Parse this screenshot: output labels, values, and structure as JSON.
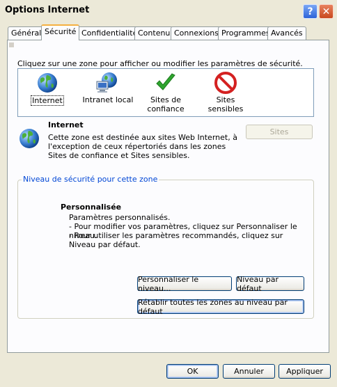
{
  "window": {
    "title": "Options Internet",
    "help_glyph": "?",
    "close_glyph": "✕"
  },
  "tabs": [
    {
      "label": "Général"
    },
    {
      "label": "Sécurité",
      "active": true
    },
    {
      "label": "Confidentialité"
    },
    {
      "label": "Contenu"
    },
    {
      "label": "Connexions"
    },
    {
      "label": "Programmes"
    },
    {
      "label": "Avancés"
    }
  ],
  "security": {
    "instruction": "Cliquez sur une zone pour afficher ou modifier les paramètres de sécurité.",
    "zones": [
      {
        "label": "Internet",
        "icon": "globe-icon",
        "selected": true
      },
      {
        "label": "Intranet local",
        "icon": "intranet-icon"
      },
      {
        "label": "Sites de confiance",
        "icon": "checkmark-icon"
      },
      {
        "label": "Sites sensibles",
        "icon": "restricted-icon"
      }
    ],
    "zone_info": {
      "title": "Internet",
      "description": "Cette zone est destinée aux sites Web Internet, à l'exception de ceux répertoriés dans les zones Sites de confiance et Sites sensibles.",
      "sites_button": "Sites"
    },
    "level": {
      "legend": "Niveau de sécurité pour cette zone",
      "name": "Personnalisée",
      "line1": "Paramètres personnalisés.",
      "line2": "- Pour modifier vos paramètres, cliquez sur Personnaliser le niveau.",
      "line3": "- Pour utiliser les paramètres recommandés, cliquez sur Niveau par défaut.",
      "custom_button": "Personnaliser le niveau...",
      "default_button": "Niveau par défaut"
    },
    "reset_button": "Rétablir toutes les zones au niveau par défaut"
  },
  "footer": {
    "ok": "OK",
    "cancel": "Annuler",
    "apply": "Appliquer"
  },
  "colors": {
    "accent_blue": "#0046d5",
    "tab_highlight": "#f5b040",
    "dialog_bg": "#ece9d8"
  }
}
